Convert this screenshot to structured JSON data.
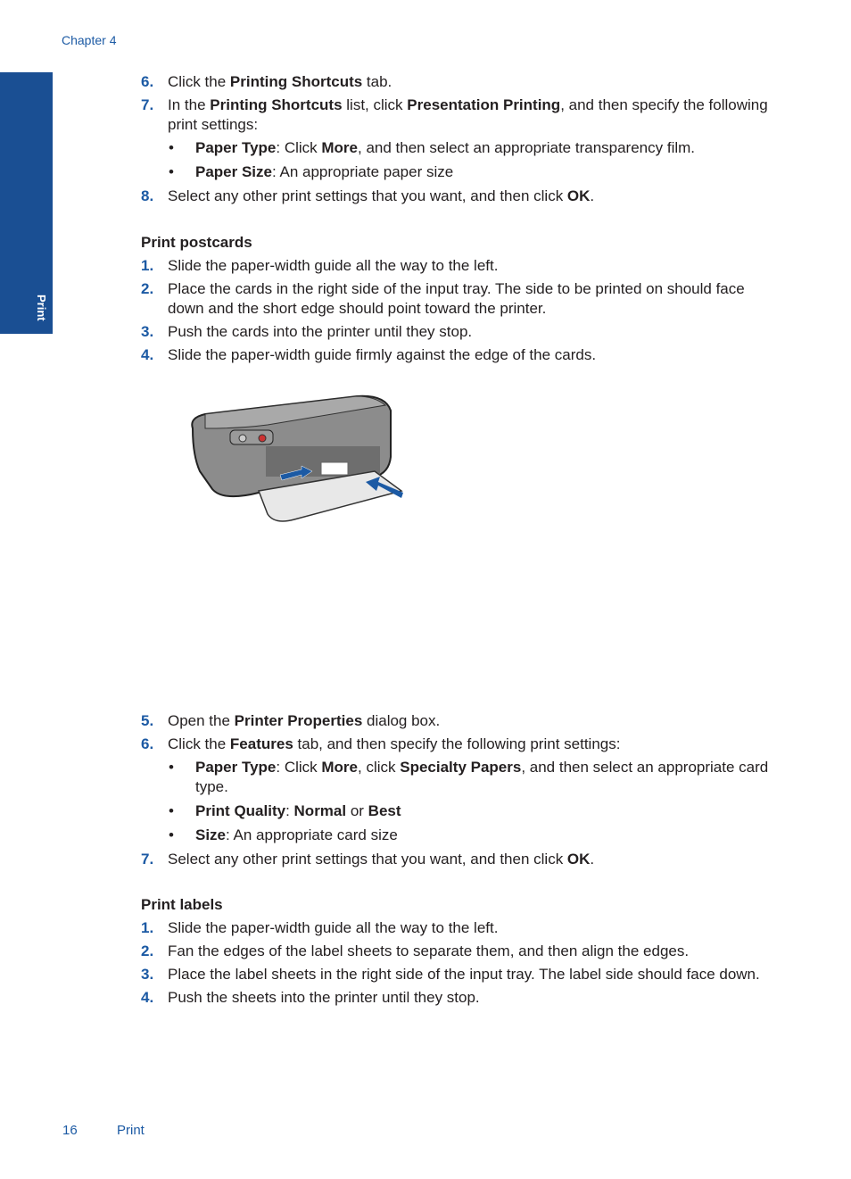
{
  "header": {
    "chapter": "Chapter 4"
  },
  "side_tab": {
    "label": "Print"
  },
  "section1": {
    "steps": [
      {
        "num": "6.",
        "parts": [
          [
            "",
            "Click the "
          ],
          [
            "b",
            "Printing Shortcuts"
          ],
          [
            "",
            " tab."
          ]
        ]
      },
      {
        "num": "7.",
        "parts": [
          [
            "",
            "In the "
          ],
          [
            "b",
            "Printing Shortcuts"
          ],
          [
            "",
            " list, click "
          ],
          [
            "b",
            "Presentation Printing"
          ],
          [
            "",
            ", and then specify the following print settings:"
          ]
        ],
        "bullets": [
          [
            [
              "b",
              "Paper Type"
            ],
            [
              "",
              ": Click "
            ],
            [
              "b",
              "More"
            ],
            [
              "",
              ", and then select an appropriate transparency film."
            ]
          ],
          [
            [
              "b",
              "Paper Size"
            ],
            [
              "",
              ": An appropriate paper size"
            ]
          ]
        ]
      },
      {
        "num": "8.",
        "parts": [
          [
            "",
            "Select any other print settings that you want, and then click "
          ],
          [
            "b",
            "OK"
          ],
          [
            "",
            "."
          ]
        ]
      }
    ]
  },
  "section2": {
    "heading": "Print postcards",
    "steps": [
      {
        "num": "1.",
        "parts": [
          [
            "",
            "Slide the paper-width guide all the way to the left."
          ]
        ]
      },
      {
        "num": "2.",
        "parts": [
          [
            "",
            "Place the cards in the right side of the input tray. The side to be printed on should face down and the short edge should point toward the printer."
          ]
        ]
      },
      {
        "num": "3.",
        "parts": [
          [
            "",
            "Push the cards into the printer until they stop."
          ]
        ]
      },
      {
        "num": "4.",
        "parts": [
          [
            "",
            "Slide the paper-width guide firmly against the edge of the cards."
          ]
        ]
      }
    ],
    "figure": "printer-loading-cards-illustration",
    "steps2": [
      {
        "num": "5.",
        "parts": [
          [
            "",
            "Open the "
          ],
          [
            "b",
            "Printer Properties"
          ],
          [
            "",
            " dialog box."
          ]
        ]
      },
      {
        "num": "6.",
        "parts": [
          [
            "",
            "Click the "
          ],
          [
            "b",
            "Features"
          ],
          [
            "",
            " tab, and then specify the following print settings:"
          ]
        ],
        "bullets": [
          [
            [
              "b",
              "Paper Type"
            ],
            [
              "",
              ": Click "
            ],
            [
              "b",
              "More"
            ],
            [
              "",
              ", click "
            ],
            [
              "b",
              "Specialty Papers"
            ],
            [
              "",
              ", and then select an appropriate card type."
            ]
          ],
          [
            [
              "b",
              "Print Quality"
            ],
            [
              "",
              ": "
            ],
            [
              "b",
              "Normal"
            ],
            [
              "",
              " or "
            ],
            [
              "b",
              "Best"
            ]
          ],
          [
            [
              "b",
              "Size"
            ],
            [
              "",
              ": An appropriate card size"
            ]
          ]
        ]
      },
      {
        "num": "7.",
        "parts": [
          [
            "",
            "Select any other print settings that you want, and then click "
          ],
          [
            "b",
            "OK"
          ],
          [
            "",
            "."
          ]
        ]
      }
    ]
  },
  "section3": {
    "heading": "Print labels",
    "steps": [
      {
        "num": "1.",
        "parts": [
          [
            "",
            "Slide the paper-width guide all the way to the left."
          ]
        ]
      },
      {
        "num": "2.",
        "parts": [
          [
            "",
            "Fan the edges of the label sheets to separate them, and then align the edges."
          ]
        ]
      },
      {
        "num": "3.",
        "parts": [
          [
            "",
            "Place the label sheets in the right side of the input tray. The label side should face down."
          ]
        ]
      },
      {
        "num": "4.",
        "parts": [
          [
            "",
            "Push the sheets into the printer until they stop."
          ]
        ]
      }
    ]
  },
  "footer": {
    "page_number": "16",
    "section_title": "Print"
  }
}
